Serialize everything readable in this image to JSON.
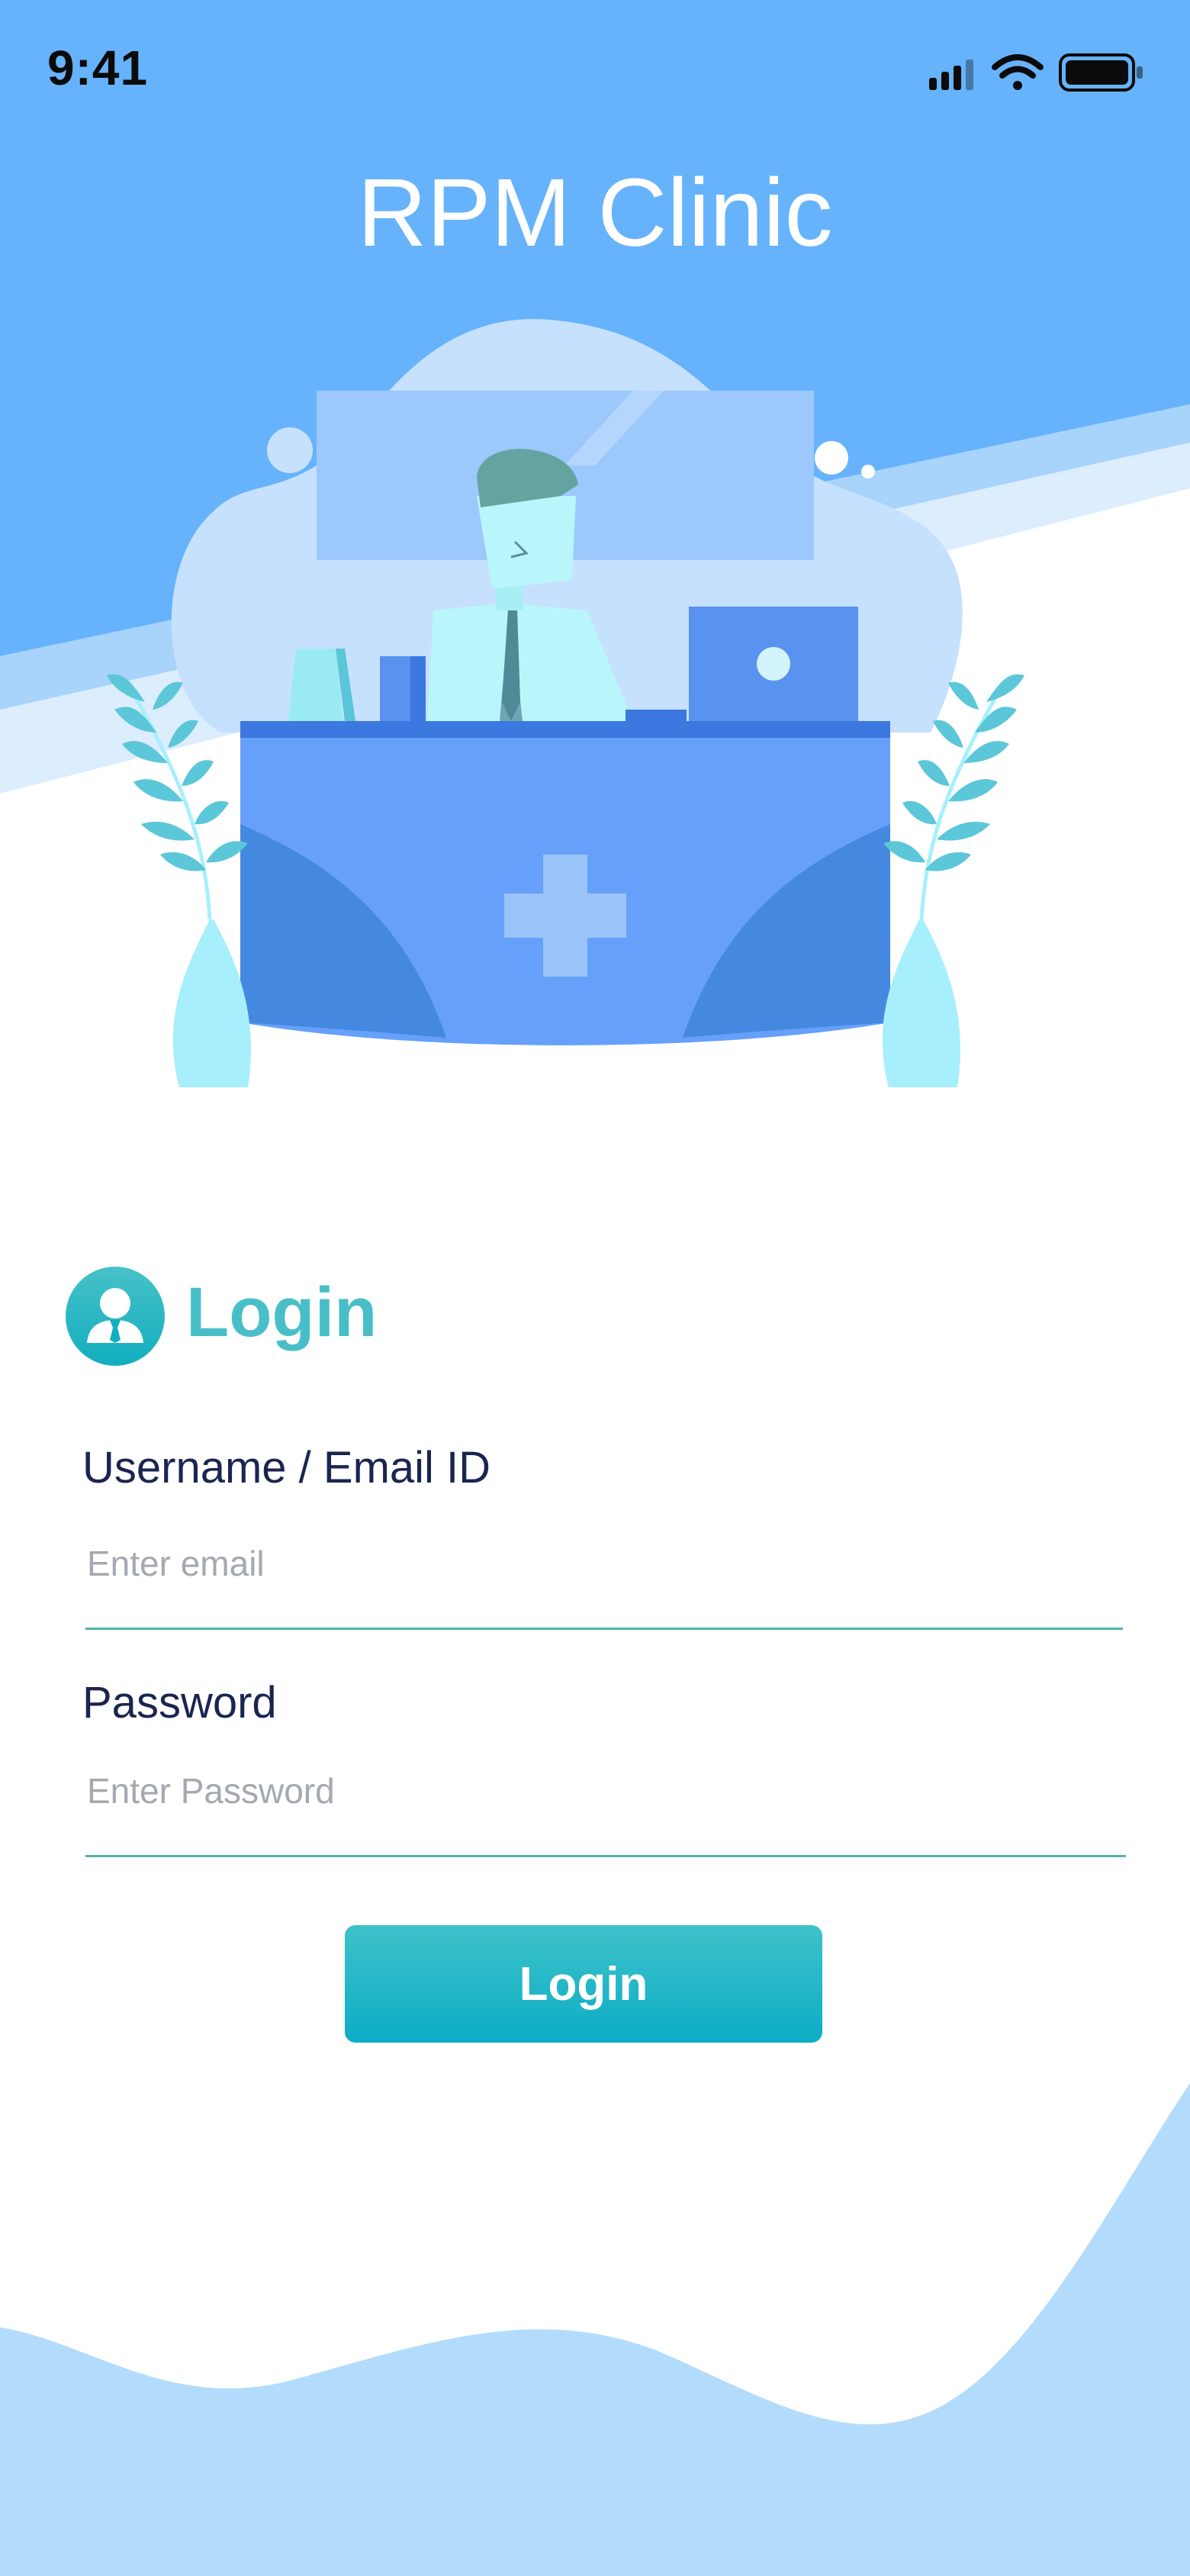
{
  "status_bar": {
    "time": "9:41"
  },
  "app": {
    "title": "RPM Clinic"
  },
  "login": {
    "heading": "Login",
    "username_label": "Username / Email ID",
    "username_placeholder": "Enter email",
    "password_label": "Password",
    "password_placeholder": "Enter Password",
    "button_label": "Login"
  },
  "icons": {
    "signal": "cellular-signal-icon",
    "wifi": "wifi-icon",
    "battery": "battery-icon",
    "user": "user-avatar-icon",
    "illustration": "doctor-reception-desk-illustration"
  },
  "colors": {
    "header_bg": "#66b3fb",
    "accent": "#48bfc8",
    "button": "#12aec4",
    "label_text": "#1a2550",
    "wave": "#b3dcfc"
  }
}
